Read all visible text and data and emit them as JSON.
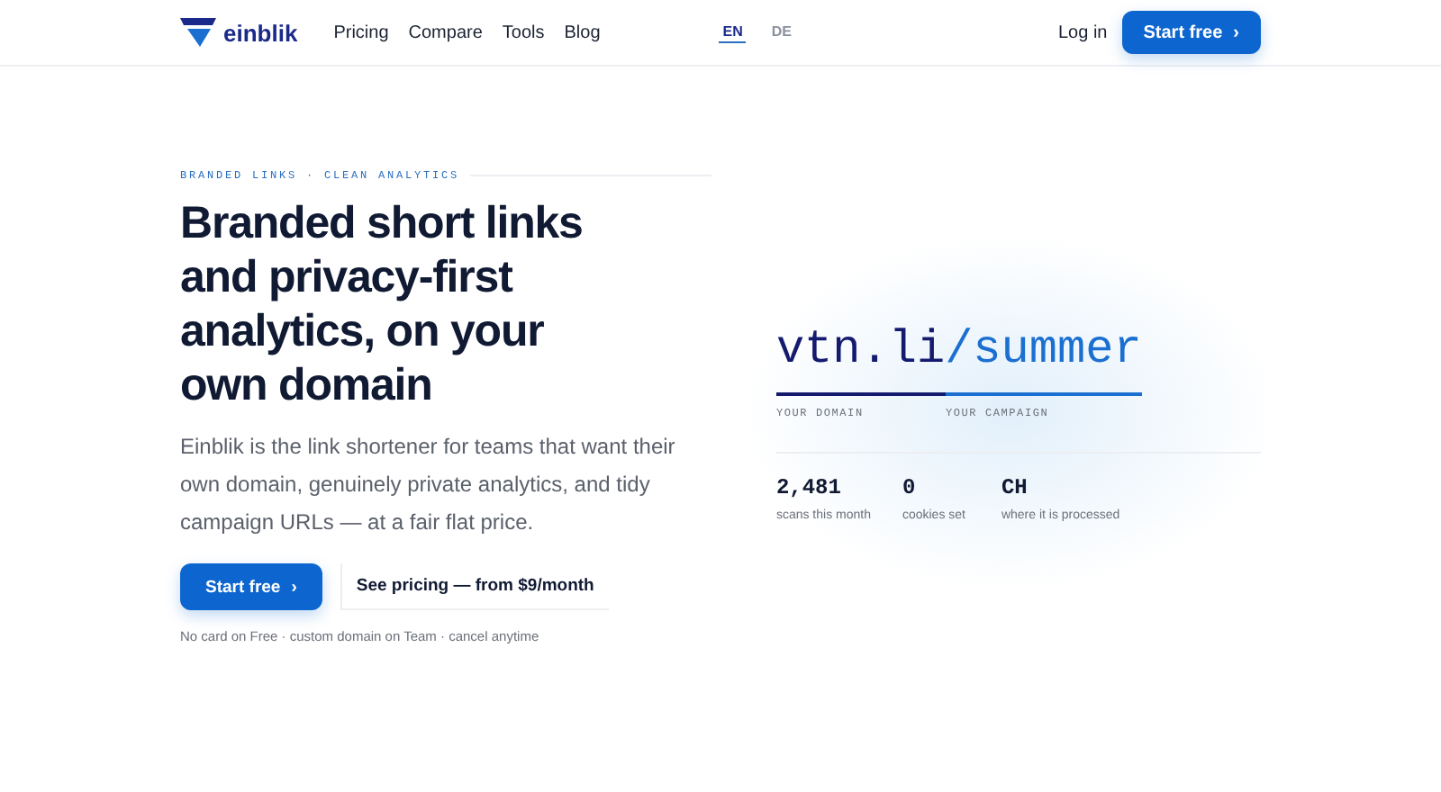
{
  "header": {
    "brand": "einblik",
    "nav": [
      "Pricing",
      "Compare",
      "Tools",
      "Blog"
    ],
    "languages": [
      {
        "label": "EN",
        "selected": true
      },
      {
        "label": "DE",
        "selected": false
      }
    ],
    "login": "Log in",
    "cta": "Start free",
    "cta_icon": "›"
  },
  "hero": {
    "eyebrow": "BRANDED LINKS · CLEAN ANALYTICS",
    "title": "Branded short links and privacy-first analytics, on your own domain",
    "lead": "Einblik is the link shortener for teams that want their own domain, genuinely private analytics, and tidy campaign URLs — at a fair flat price.",
    "primary": "Start free",
    "primary_icon": "›",
    "secondary": "See pricing — from $9/month",
    "note": "No card on Free · custom domain on Team · cancel anytime"
  },
  "demo": {
    "domain": "vtn.li",
    "slug": "/summer",
    "domain_label": "YOUR DOMAIN",
    "slug_label": "YOUR CAMPAIGN",
    "stats": [
      {
        "value": "2,481",
        "label": "scans this month"
      },
      {
        "value": "0",
        "label": "cookies set"
      },
      {
        "value": "CH",
        "label": "where it is processed"
      }
    ]
  }
}
